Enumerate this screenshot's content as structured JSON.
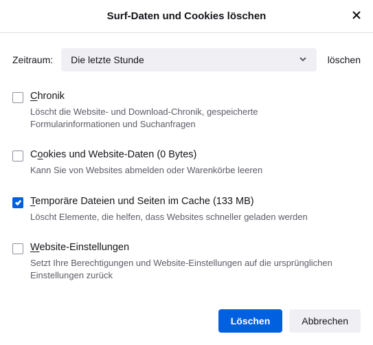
{
  "header": {
    "title": "Surf-Daten und Cookies löschen"
  },
  "timerange": {
    "label": "Zeitraum:",
    "selected": "Die letzte Stunde",
    "suffix": "löschen"
  },
  "options": [
    {
      "checked": false,
      "accessKey": "C",
      "title_head": "C",
      "title_rest": "hronik",
      "description": "Löscht die Website- und Download-Chronik, gespeicherte Formularinformationen und Suchanfragen"
    },
    {
      "checked": false,
      "accessKey": "o",
      "title_head": "C",
      "title_underline": "o",
      "title_rest": "okies und Website-Daten (0 Bytes)",
      "description": "Kann Sie von Websites abmelden oder Warenkörbe leeren"
    },
    {
      "checked": true,
      "accessKey": "T",
      "title_head": "T",
      "title_rest": "emporäre Dateien und Seiten im Cache (133 MB)",
      "description": "Löscht Elemente, die helfen, dass Websites schneller geladen werden"
    },
    {
      "checked": false,
      "accessKey": "W",
      "title_head": "W",
      "title_rest": "ebsite-Einstellungen",
      "description": "Setzt Ihre Berechtigungen und Website-Einstellungen auf die ursprünglichen Einstellungen zurück"
    }
  ],
  "footer": {
    "primary": "Löschen",
    "secondary": "Abbrechen"
  }
}
